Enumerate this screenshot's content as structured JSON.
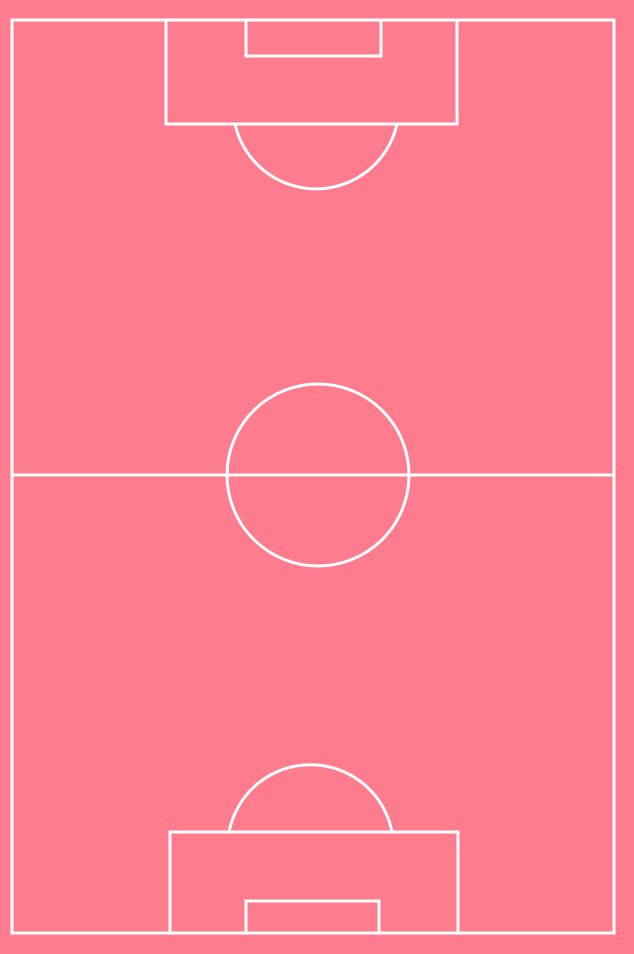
{
  "pitch": {
    "surface_color": "#ff7b8e",
    "line_color": "#ffffff",
    "orientation": "vertical",
    "markings": [
      "touchlines",
      "goal-lines",
      "halfway-line",
      "center-circle",
      "penalty-areas",
      "goal-areas",
      "penalty-arcs"
    ]
  }
}
